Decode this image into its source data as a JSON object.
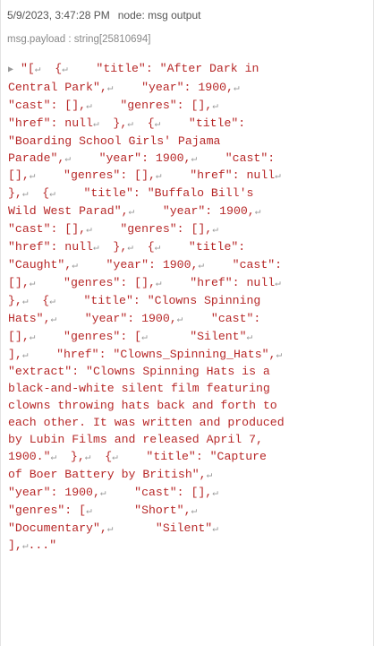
{
  "message": {
    "timestamp": "5/9/2023, 3:47:28 PM",
    "node": "node: msg output",
    "meta": "msg.payload : string[25810694]",
    "expand_icon": "triangle-right-icon",
    "newline_glyph": "↵",
    "colors": {
      "payload_text": "#b72828",
      "header_text": "#555555",
      "meta_text": "#8a8a8a"
    },
    "payload_lines": [
      "\"[↵  {↵    \"title\": \"After Dark in",
      "Central Park\",↵    \"year\": 1900,↵",
      "\"cast\": [],↵    \"genres\": [],↵",
      "\"href\": null↵  },↵  {↵    \"title\":",
      "\"Boarding School Girls' Pajama",
      "Parade\",↵    \"year\": 1900,↵    \"cast\":",
      "[],↵    \"genres\": [],↵    \"href\": null↵",
      "},↵  {↵    \"title\": \"Buffalo Bill's",
      "Wild West Parad\",↵    \"year\": 1900,↵",
      "\"cast\": [],↵    \"genres\": [],↵",
      "\"href\": null↵  },↵  {↵    \"title\":",
      "\"Caught\",↵    \"year\": 1900,↵    \"cast\":",
      "[],↵    \"genres\": [],↵    \"href\": null↵",
      "},↵  {↵    \"title\": \"Clowns Spinning",
      "Hats\",↵    \"year\": 1900,↵    \"cast\":",
      "[],↵    \"genres\": [↵      \"Silent\"↵",
      "],↵    \"href\": \"Clowns_Spinning_Hats\",↵",
      "\"extract\": \"Clowns Spinning Hats is a",
      "black-and-white silent film featuring",
      "clowns throwing hats back and forth to",
      "each other. It was written and produced",
      "by Lubin Films and released April 7,",
      "1900.\"↵  },↵  {↵    \"title\": \"Capture",
      "of Boer Battery by British\",↵",
      "\"year\": 1900,↵    \"cast\": [],↵",
      "\"genres\": [↵      \"Short\",↵",
      "\"Documentary\",↵      \"Silent\"↵",
      "],↵...\""
    ]
  }
}
